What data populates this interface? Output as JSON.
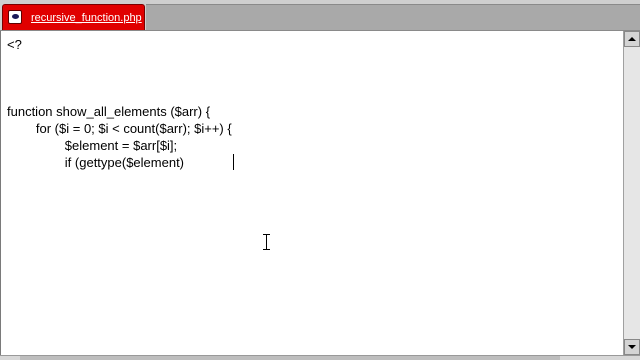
{
  "tab": {
    "label": "recursive_function.php",
    "icon": "php-file-icon",
    "color": "#e00000"
  },
  "editor": {
    "lines": [
      "<?",
      "",
      "",
      "",
      "function show_all_elements ($arr) {",
      "        for ($i = 0; $i < count($arr); $i++) {",
      "                $element = $arr[$i];",
      "                if (gettype($element)"
    ]
  },
  "scrollbar": {
    "up_icon": "arrow-up-icon",
    "down_icon": "arrow-down-icon"
  }
}
